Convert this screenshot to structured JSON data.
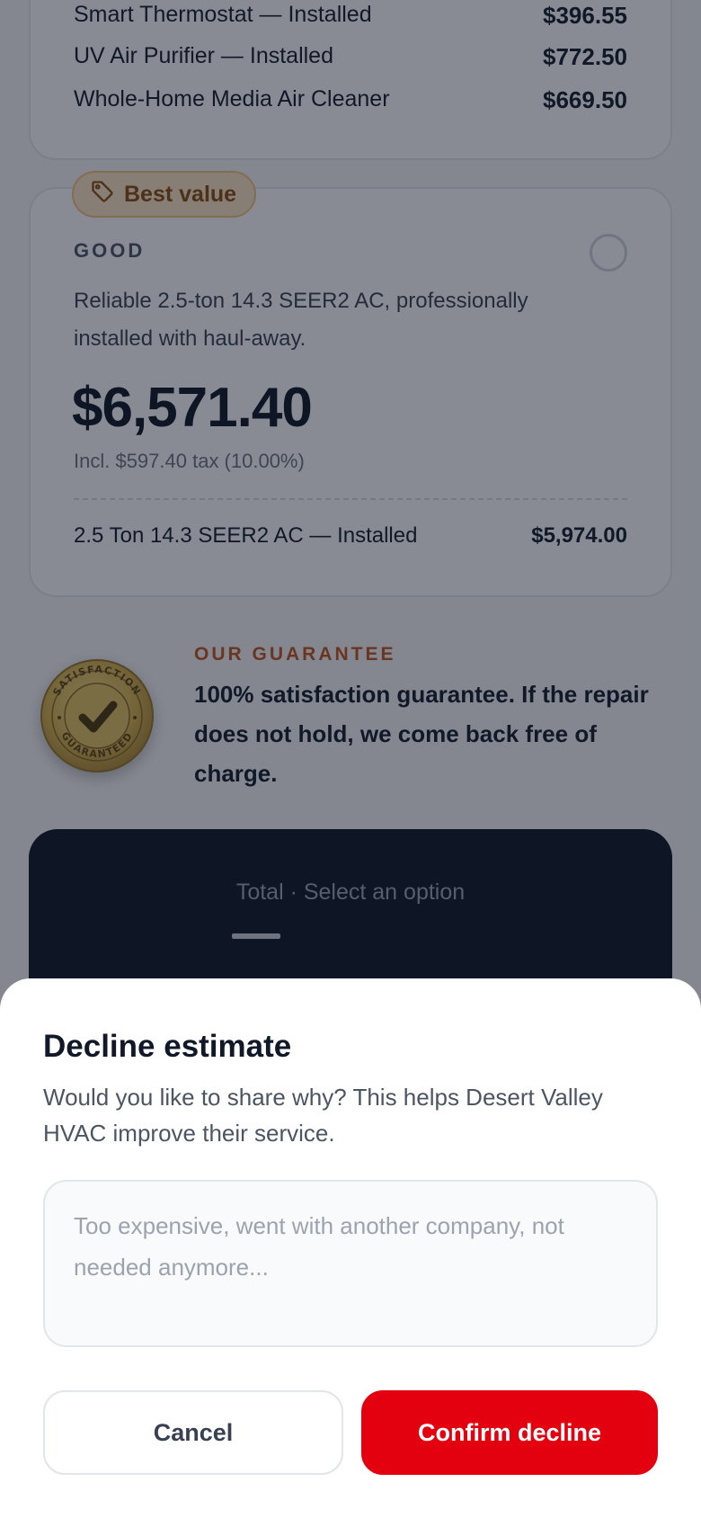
{
  "previous_option": {
    "items": [
      {
        "label": "Smart Thermostat — Installed",
        "price": "$396.55"
      },
      {
        "label": "UV Air Purifier — Installed",
        "price": "$772.50"
      },
      {
        "label": "Whole-Home Media Air Cleaner",
        "price": "$669.50"
      }
    ]
  },
  "good_option": {
    "badge": "Best value",
    "tier": "GOOD",
    "description": "Reliable 2.5-ton 14.3 SEER2 AC, professionally installed with haul-away.",
    "price": "$6,571.40",
    "tax_note": "Incl. $597.40 tax (10.00%)",
    "line_item": {
      "label": "2.5 Ton 14.3 SEER2 AC — Installed",
      "price": "$5,974.00"
    }
  },
  "guarantee": {
    "title": "OUR GUARANTEE",
    "text": "100% satisfaction guarantee. If the repair does not hold, we come back free of charge.",
    "seal_top": "SATISFACTION",
    "seal_bottom": "GUARANTEED"
  },
  "total_bar": {
    "label": "Total · Select an option"
  },
  "decline_sheet": {
    "title": "Decline estimate",
    "subtitle": "Would you like to share why? This helps Desert Valley HVAC improve their service.",
    "reason_placeholder": "Too expensive, went with another company, not needed anymore...",
    "reason_value": "",
    "cancel_label": "Cancel",
    "confirm_label": "Confirm decline"
  },
  "colors": {
    "confirm": "#e3000f",
    "badge_bg": "#fde7c4",
    "guarantee_title": "#c2541a",
    "total_bar": "#0b1220"
  },
  "icons": {
    "badge": "tag-icon",
    "seal": "checkmark-icon"
  }
}
